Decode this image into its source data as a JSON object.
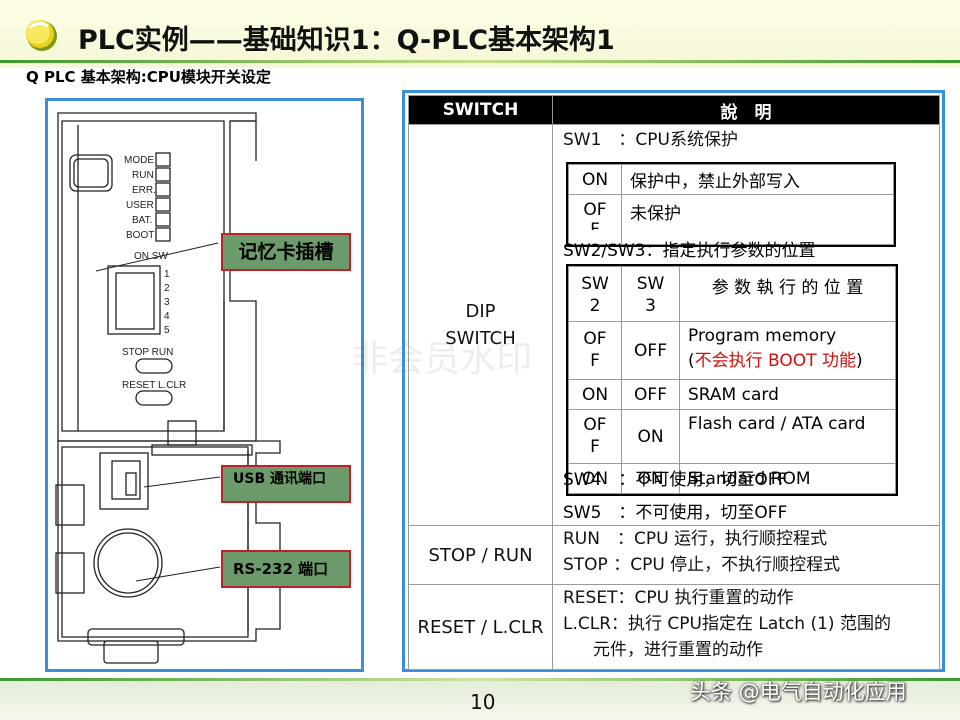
{
  "header": {
    "title": "PLC实例——基础知识1：Q-PLC基本架构1",
    "subtitle": "Q PLC 基本架构:CPU模块开关设定"
  },
  "device": {
    "leds": [
      "MODE",
      "RUN",
      "ERR.",
      "USER",
      "BAT.",
      "BOOT"
    ],
    "on_sw": "ON  SW",
    "sw_numbers": [
      "1",
      "2",
      "3",
      "4",
      "5"
    ],
    "stop_run": "STOP   RUN",
    "reset_lclr": "RESET  L.CLR",
    "callouts": {
      "memory_card": "记忆卡插槽",
      "usb": "USB 通讯端口",
      "rs232": "RS-232 端口"
    }
  },
  "table": {
    "header": {
      "switch": "SWITCH",
      "desc": "說　明"
    },
    "dip": {
      "label_1": "DIP",
      "label_2": "SWITCH",
      "sw1": "SW1　：CPU系统保护",
      "sw1_rows": [
        {
          "state": "ON",
          "desc": "保护中，禁止外部写入"
        },
        {
          "state": "OFF",
          "desc": "未保护"
        }
      ],
      "sw23": "SW2/SW3：指定执行参数的位置",
      "sw23_header": {
        "sw2": "SW 2",
        "sw3": "SW 3",
        "loc": "参 数 執 行 的 位 置"
      },
      "sw23_rows": [
        {
          "sw2": "OFF",
          "sw3": "OFF",
          "loc": "Program memory",
          "note_pre": "(",
          "note": "不会执行 BOOT 功能",
          "note_post": ")"
        },
        {
          "sw2": "ON",
          "sw3": "OFF",
          "loc": "SRAM card"
        },
        {
          "sw2": "OFF",
          "sw3": "ON",
          "loc": "Flash card / ATA card"
        },
        {
          "sw2": "ON",
          "sw3": "ON",
          "loc": "Standard ROM"
        }
      ],
      "sw4": "SW4　：不可使用，切至OFF",
      "sw5": "SW5　：不可使用，切至OFF"
    },
    "stop_run": {
      "label": "STOP / RUN",
      "line1": "RUN　：CPU 运行，执行顺控程式",
      "line2": "STOP ：CPU 停止，不执行顺控程式"
    },
    "reset": {
      "label": "RESET / L.CLR",
      "line1": "RESET：CPU 执行重置的动作",
      "line2": "L.CLR：执行 CPU指定在 Latch (1) 范围的",
      "line3": "元件，进行重置的动作"
    }
  },
  "watermark": "非会员水印",
  "footer": {
    "page": "10",
    "brand": "头条 @电气自动化应用"
  }
}
